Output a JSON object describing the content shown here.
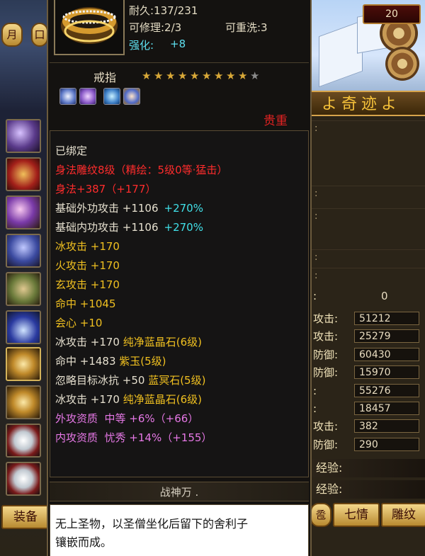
{
  "right_panel": {
    "level": "20",
    "banner": "よ奇迹よ",
    "dim_rows": [
      ":",
      ":",
      ":",
      ":",
      ":"
    ],
    "zero_row": {
      "label": ":",
      "value": "0"
    },
    "stats": [
      {
        "label": "攻击:",
        "value": "51212"
      },
      {
        "label": "攻击:",
        "value": "25279"
      },
      {
        "label": "防御:",
        "value": "60430"
      },
      {
        "label": "防御:",
        "value": "15970"
      },
      {
        "label": ":",
        "value": "55276"
      },
      {
        "label": ":",
        "value": "18457"
      },
      {
        "label": "攻击:",
        "value": "382"
      },
      {
        "label": "防御:",
        "value": "290"
      }
    ],
    "exp_rows": [
      "经验:",
      "经验:"
    ],
    "buttons": [
      "七情",
      "雕纹"
    ]
  },
  "left_sidebar": {
    "top_buttons": [
      "月",
      "口"
    ],
    "equip_button": "装备"
  },
  "tooltip": {
    "durability": "耐久:137/231",
    "repairable": "可修理:2/3",
    "rewashable": "可重洗:3",
    "reinforce_label": "强化:",
    "reinforce_value": "+8",
    "item_type": "戒指",
    "stars_filled": 9,
    "stars_total": 10,
    "rarity": "贵重",
    "lines": [
      {
        "text": "已绑定",
        "color": "w"
      },
      {
        "text": "身法雕纹8级（精绘：5级0等·猛击）",
        "color": "r"
      },
      {
        "text": "身法+387（+177）",
        "color": "r"
      },
      {
        "text": "基础外功攻击 +1106",
        "color": "w",
        "extra": "+270%"
      },
      {
        "text": "基础内功攻击 +1106",
        "color": "w",
        "extra": "+270%"
      },
      {
        "text": "冰攻击 +170",
        "color": "y"
      },
      {
        "text": "火攻击 +170",
        "color": "y"
      },
      {
        "text": "玄攻击 +170",
        "color": "y"
      },
      {
        "text": "命中 +1045",
        "color": "y"
      },
      {
        "text": "会心 +10",
        "color": "y"
      },
      {
        "text": "冰攻击 +170 纯净蓝晶石(6级)",
        "color": "w",
        "gem": true
      },
      {
        "text": "命中 +1483 紫玉(5级)",
        "color": "w",
        "gem": true
      },
      {
        "text": "忽略目标冰抗 +50 蓝冥石(5级)",
        "color": "w",
        "gem": true
      },
      {
        "text": "冰攻击 +170 纯净蓝晶石(6级)",
        "color": "w",
        "gem": true
      },
      {
        "text": "外攻资质  中等 +6%（+66）",
        "color": "p"
      },
      {
        "text": "内攻资质  忧秀 +14%（+155）",
        "color": "p"
      }
    ],
    "crafter": "战神万 .",
    "description": [
      "无上圣物，以圣僧坐化后留下的舍利子",
      "镶嵌而成。"
    ]
  },
  "colors": {
    "red": "#ff2c2c",
    "yellow": "#f0c020",
    "cyan": "#40e0e8",
    "pink": "#e678e6",
    "white": "#e6e0cf"
  }
}
